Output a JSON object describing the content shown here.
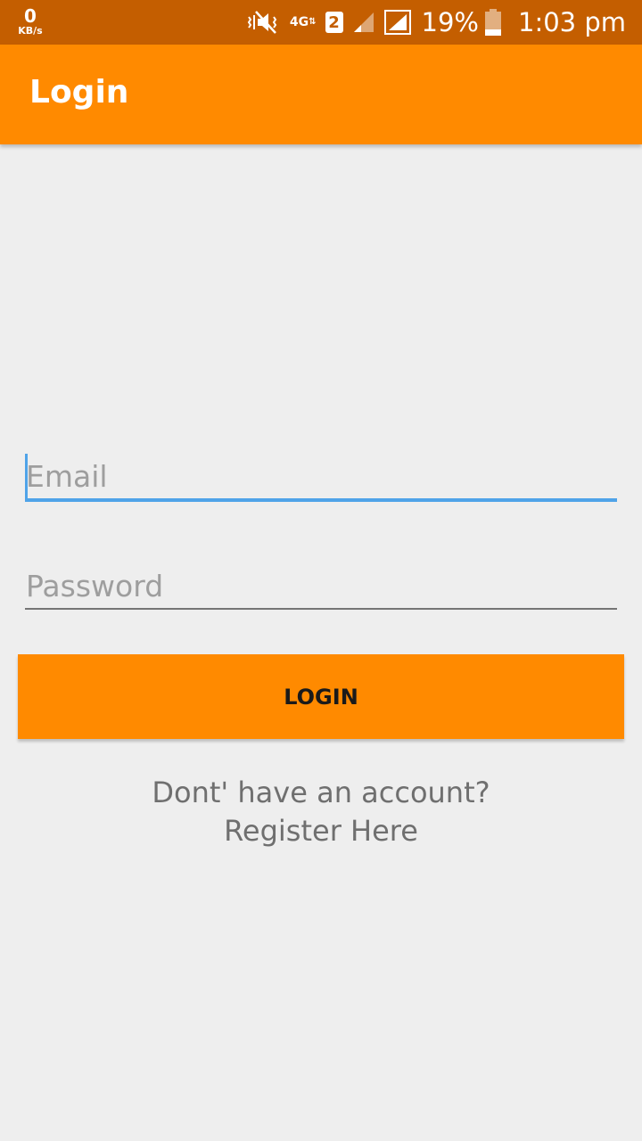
{
  "status_bar": {
    "net_speed_value": "0",
    "net_speed_unit": "KB/s",
    "mute_icon": "vibrate-mute-icon",
    "network_type": "4G",
    "sim_slot": "2",
    "battery_percent": "19%",
    "time": "1:03 pm"
  },
  "app_bar": {
    "title": "Login",
    "background_color": "#ff8a00"
  },
  "form": {
    "email_placeholder": "Email",
    "email_value": "",
    "password_placeholder": "Password",
    "password_value": "",
    "login_label": "LOGIN",
    "register_line1": "Dont' have an account?",
    "register_line2": "Register Here"
  },
  "colors": {
    "accent": "#ff8a00",
    "status_bar": "#c45e00",
    "focus": "#4fa3e8"
  }
}
